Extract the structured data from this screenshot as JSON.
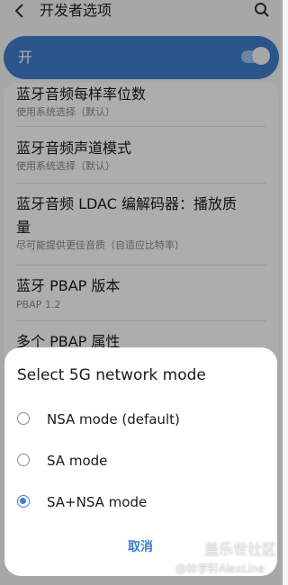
{
  "header": {
    "title": "开发者选项",
    "back_icon": "back-arrow-icon",
    "search_icon": "search-icon"
  },
  "master": {
    "label": "开",
    "enabled": true,
    "accent": "#3f7fcf"
  },
  "items": [
    {
      "title": "蓝牙音频每样率位数",
      "subtitle": "使用系统选择（默认）"
    },
    {
      "title": "蓝牙音频声道模式",
      "subtitle": "使用系统选择（默认）"
    },
    {
      "title": "蓝牙音频 LDAC 编解码器：播放质",
      "title2": "量",
      "subtitle": "尽可能提供更佳音质（自适应比特率）"
    },
    {
      "title": "蓝牙 PBAP 版本",
      "subtitle": "PBAP 1.2"
    },
    {
      "title": "多个 PBAP 属性"
    }
  ],
  "dialog": {
    "title": "Select 5G network mode",
    "options": [
      {
        "label": "NSA mode (default)",
        "selected": false
      },
      {
        "label": "SA mode",
        "selected": false
      },
      {
        "label": "SA+NSA mode",
        "selected": true
      }
    ],
    "cancel_label": "取消"
  },
  "watermark": {
    "site": "盖乐世社区",
    "user": "@林学轩AlexLine"
  }
}
